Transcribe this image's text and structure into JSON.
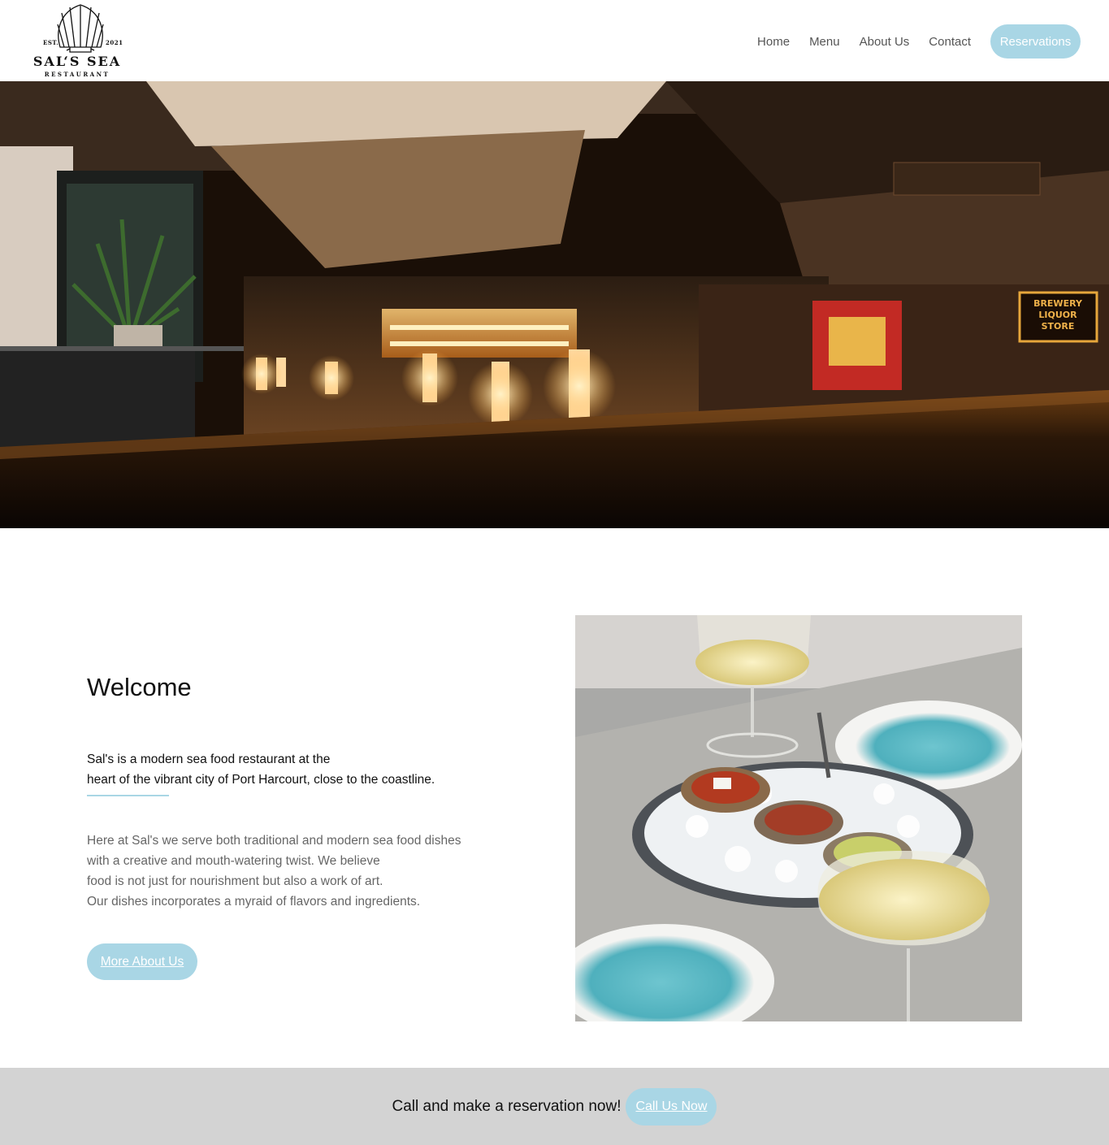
{
  "header": {
    "logo": {
      "est": "EST.",
      "year": "2021",
      "name": "SAL‘S SEA",
      "sub": "RESTAURANT"
    },
    "nav": {
      "home": "Home",
      "menu": "Menu",
      "about": "About Us",
      "contact": "Contact",
      "reservations": "Reservations"
    }
  },
  "hero": {
    "image": "restaurant-interior-photo",
    "sign_text": [
      "BREWERY",
      "LIQUOR",
      "STORE"
    ]
  },
  "welcome": {
    "title": "Welcome",
    "lead_lines": [
      "Sal's is a modern sea food restaurant at the",
      "heart of the vibrant city of Port Harcourt, close to the coastline."
    ],
    "body_lines": [
      "Here at Sal's we serve both traditional and modern sea food dishes",
      "with a creative and mouth-watering twist. We believe",
      "food is not just for nourishment but also a work of art.",
      "Our dishes incorporates a myraid of flavors and ingredients."
    ],
    "button": "More About Us",
    "image": "oysters-and-wine-photo"
  },
  "cta": {
    "text": "Call and make a reservation now!",
    "button": "Call Us Now"
  },
  "colors": {
    "accent": "#a9d6e5",
    "cta_band": "#d3d3d3"
  }
}
